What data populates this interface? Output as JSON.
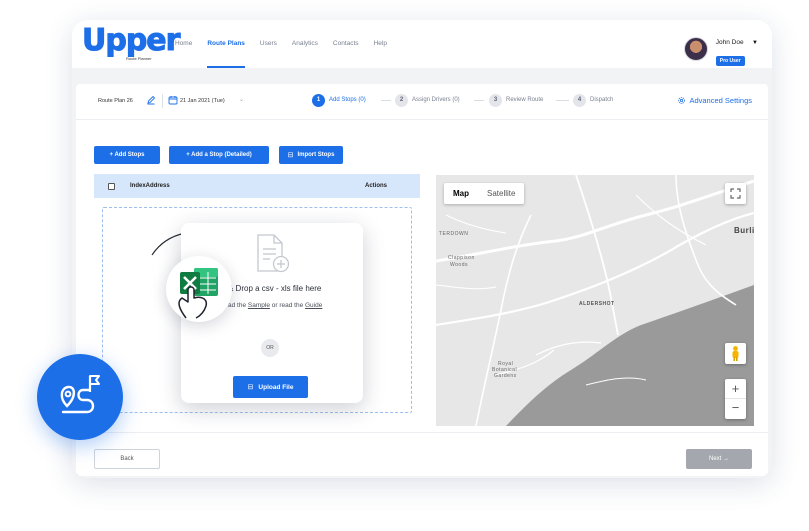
{
  "app": {
    "logo_text": "Upper",
    "logo_subtitle": "Route Planner",
    "brand_color": "#1d6fe8"
  },
  "nav": {
    "items": [
      {
        "label": "Home",
        "active": false
      },
      {
        "label": "Route Plans",
        "active": true
      },
      {
        "label": "Users",
        "active": false
      },
      {
        "label": "Analytics",
        "active": false
      },
      {
        "label": "Contacts",
        "active": false
      },
      {
        "label": "Help",
        "active": false
      }
    ]
  },
  "user": {
    "name": "John Doe",
    "badge": "Pro User"
  },
  "route": {
    "name": "Route Plan 26",
    "date": "21 Jan 2021 (Tue)"
  },
  "steps": [
    {
      "num": "1",
      "label": "Add Stops (0)",
      "active": true
    },
    {
      "num": "2",
      "label": "Assign Drivers (0)",
      "active": false
    },
    {
      "num": "3",
      "label": "Review Route",
      "active": false
    },
    {
      "num": "4",
      "label": "Dispatch",
      "active": false
    }
  ],
  "advanced_settings": "Advanced Settings",
  "toolbar": {
    "add_stops": "+ Add Stops",
    "add_stop_detailed": "+ Add a Stop (Detailed)",
    "import_stops": "Import Stops"
  },
  "table": {
    "headers": {
      "index_address": "IndexAddress",
      "actions": "Actions"
    }
  },
  "upload": {
    "drop_text": "& Drop a csv - xls file here",
    "sample_prefix": "ad the ",
    "sample_link": "Sample",
    "sample_mid": " or read the ",
    "guide_link": "Guide",
    "or": "OR",
    "button": "Upload File"
  },
  "map": {
    "tabs": [
      "Map",
      "Satellite"
    ],
    "labels": {
      "town": "ALDERSHOT",
      "burl": "Burli",
      "terdown": "TERDOWN",
      "clappison": "Clappison",
      "woods": "Woods",
      "royal": "Royal",
      "botanical": "Botanical",
      "gardens": "Gardens"
    },
    "zoom_in": "+",
    "zoom_out": "−"
  },
  "footer": {
    "back": "Back",
    "next": "Next →"
  }
}
